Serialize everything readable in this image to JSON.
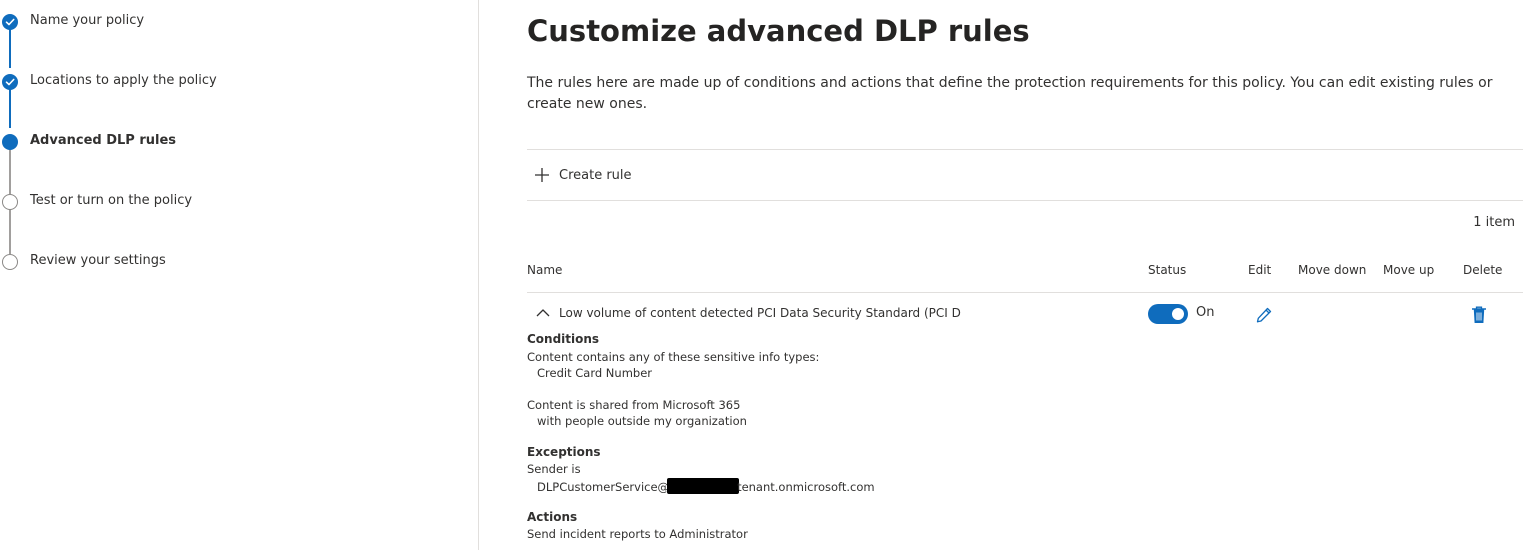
{
  "stepper": {
    "steps": [
      {
        "label": "Name your policy",
        "state": "done"
      },
      {
        "label": "Locations to apply the policy",
        "state": "done"
      },
      {
        "label": "Advanced DLP rules",
        "state": "current"
      },
      {
        "label": "Test or turn on the policy",
        "state": "todo"
      },
      {
        "label": "Review your settings",
        "state": "todo"
      }
    ]
  },
  "main": {
    "title": "Customize advanced DLP rules",
    "description": "The rules here are made up of conditions and actions that define the protection requirements for this policy. You can edit existing rules or create new ones.",
    "create_rule_label": "Create rule",
    "item_count": "1 item"
  },
  "table": {
    "headers": {
      "name": "Name",
      "status": "Status",
      "edit": "Edit",
      "move_down": "Move down",
      "move_up": "Move up",
      "delete": "Delete"
    },
    "rows": [
      {
        "name": "Low volume of content detected PCI Data Security Standard (PCI D",
        "status": "On",
        "expanded": true,
        "details": {
          "conditions_label": "Conditions",
          "cond1": "Content contains any of these sensitive info types:",
          "cond1_value": "Credit Card Number",
          "cond2": "Content is shared from Microsoft 365",
          "cond2_value": "with people outside my organization",
          "exceptions_label": "Exceptions",
          "exc1": "Sender is",
          "exc1_value_prefix": "DLPCustomerService@",
          "exc1_value_suffix": "tenant.onmicrosoft.com",
          "actions_label": "Actions",
          "act1": "Send incident reports to Administrator"
        }
      }
    ]
  },
  "colors": {
    "accent": "#0f6cbd",
    "text": "#323130",
    "divider": "#e1dfdd"
  },
  "icons": {
    "check": "checkmark-icon",
    "plus": "plus-icon",
    "chevron": "chevron-up-icon",
    "edit": "pencil-icon",
    "delete": "trash-icon"
  }
}
